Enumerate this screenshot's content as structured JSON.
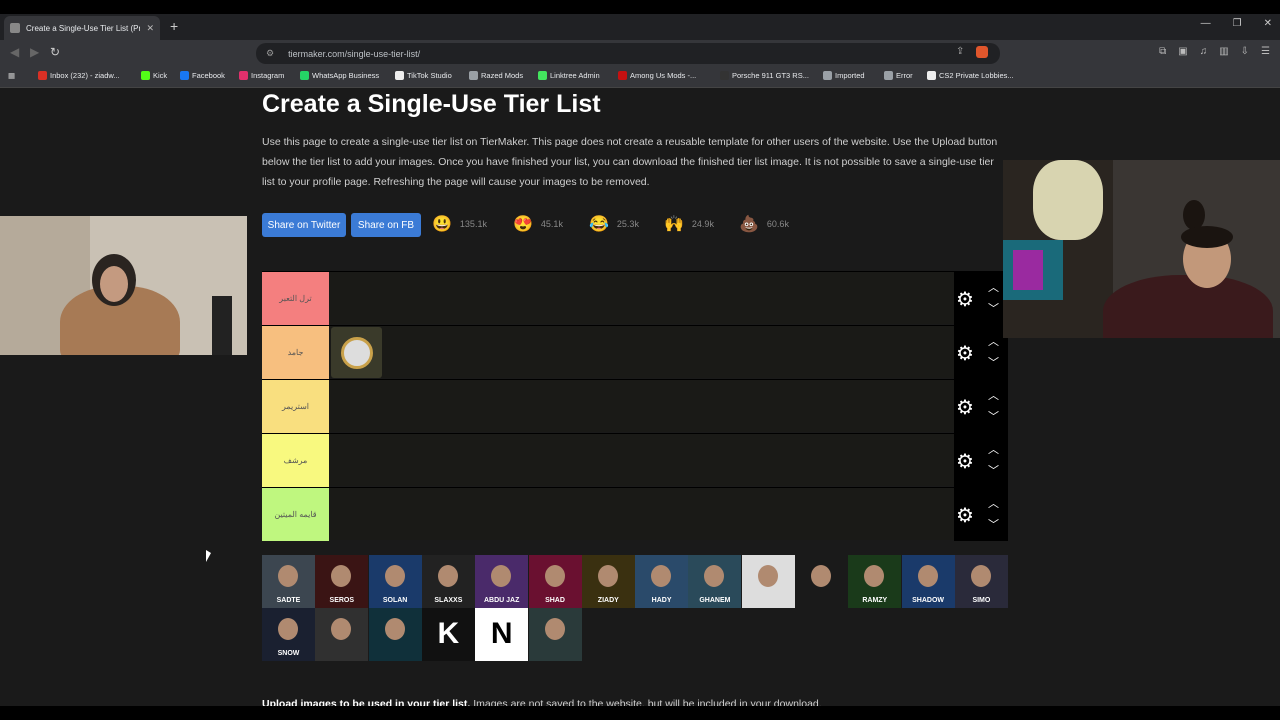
{
  "browser": {
    "tab_title": "Create a Single-Use Tier List (Pr...",
    "new_tab": "+",
    "url": "tiermaker.com/single-use-tier-list/",
    "window_buttons": [
      "—",
      "❐",
      "✕"
    ],
    "bookmarks": [
      {
        "label": "Inbox (232) - ziadw...",
        "color": "#d93025"
      },
      {
        "label": "Kick",
        "color": "#53fc18"
      },
      {
        "label": "Facebook",
        "color": "#1877f2"
      },
      {
        "label": "Instagram",
        "color": "#e1306c"
      },
      {
        "label": "WhatsApp Business",
        "color": "#25d366"
      },
      {
        "label": "TikTok Studio",
        "color": "#eeeeee"
      },
      {
        "label": "Razed Mods",
        "color": "#9aa0a6"
      },
      {
        "label": "Linktree Admin",
        "color": "#43e55e"
      },
      {
        "label": "Among Us Mods -...",
        "color": "#c51111"
      },
      {
        "label": "Porsche 911 GT3 RS...",
        "color": "#333333"
      },
      {
        "label": "Imported",
        "color": "#9aa0a6"
      },
      {
        "label": "Error",
        "color": "#9aa0a6"
      },
      {
        "label": "CS2 Private Lobbies...",
        "color": "#eeeeee"
      }
    ]
  },
  "page": {
    "title": "Create a Single-Use Tier List",
    "description": "Use this page to create a single-use tier list on TierMaker. This page does not create a reusable template for other users of the website. Use the Upload button below the tier list to add your images. Once you have finished your list, you can download the finished tier list image. It is not possible to save a single-use tier list to your profile page. Refreshing the page will cause your images to be removed.",
    "share_twitter": "Share on Twitter",
    "share_fb": "Share on FB",
    "reactions": [
      {
        "emoji": "😃",
        "count": "135.1k"
      },
      {
        "emoji": "😍",
        "count": "45.1k"
      },
      {
        "emoji": "😂",
        "count": "25.3k"
      },
      {
        "emoji": "🙌",
        "count": "24.9k"
      },
      {
        "emoji": "💩",
        "count": "60.6k"
      }
    ],
    "tiers": [
      {
        "label": "ترل التعبر",
        "color": "#f47f7f"
      },
      {
        "label": "جامد",
        "color": "#f7bf7f"
      },
      {
        "label": "استريمر",
        "color": "#f9df7f"
      },
      {
        "label": "مرشف",
        "color": "#f8f97f"
      },
      {
        "label": "قايمه الميتين",
        "color": "#bff77f"
      }
    ],
    "gallery": [
      {
        "text": "SADTE",
        "bg": "#3c4650"
      },
      {
        "text": "SEROS",
        "bg": "#3a1414"
      },
      {
        "text": "SOLAN",
        "bg": "#1a3a6a"
      },
      {
        "text": "SLAXXS",
        "bg": "#222222"
      },
      {
        "text": "ABDU JAZ",
        "bg": "#4a2a6a"
      },
      {
        "text": "SHAD",
        "bg": "#6a1030"
      },
      {
        "text": "ZIADY",
        "bg": "#3a3010"
      },
      {
        "text": "HADY",
        "bg": "#2a4a6a"
      },
      {
        "text": "GHANEM",
        "bg": "#2a4a5a"
      },
      {
        "text": "",
        "bg": "#dddddd"
      },
      {
        "text": "",
        "bg": "#1a1a1a"
      },
      {
        "text": "RAMZY",
        "bg": "#1a3a1a"
      },
      {
        "text": "SHADOW",
        "bg": "#1a3a6a"
      },
      {
        "text": "SIMO",
        "bg": "#2a2a3a"
      },
      {
        "text": "SNOW",
        "bg": "#1a2030"
      },
      {
        "text": "",
        "bg": "#303030"
      },
      {
        "text": "",
        "bg": "#10303a"
      },
      {
        "text": "K",
        "bg": "#111111"
      },
      {
        "text": "N",
        "bg": "#ffffff"
      },
      {
        "text": "",
        "bg": "#2a3a3a"
      }
    ],
    "footer_bold": "Upload images to be used in your tier list.",
    "footer_rest": " Images are not saved to the website, but will be included in your download."
  }
}
